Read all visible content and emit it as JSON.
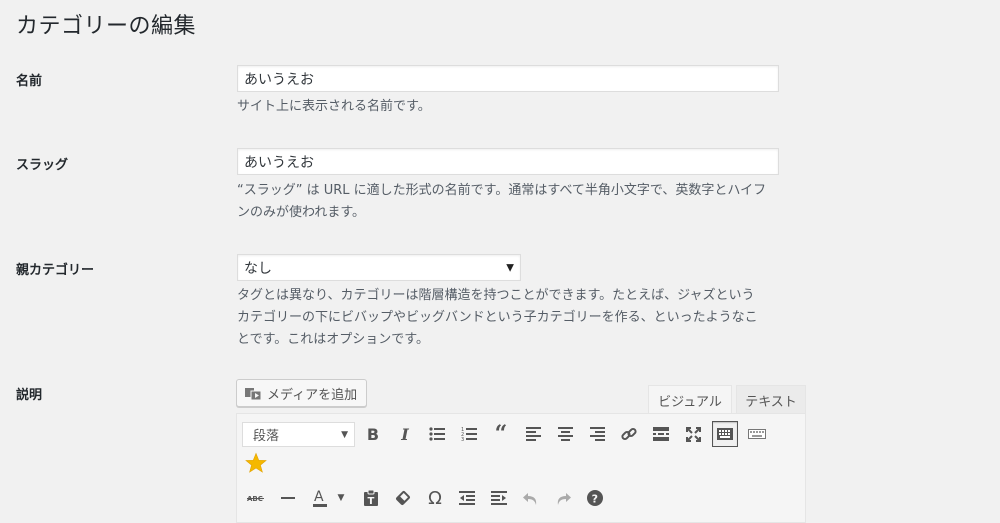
{
  "page": {
    "title": "カテゴリーの編集"
  },
  "name": {
    "label": "名前",
    "value": "あいうえお",
    "description": "サイト上に表示される名前です。"
  },
  "slug": {
    "label": "スラッグ",
    "value": "あいうえお",
    "description_1": "“スラッグ” は URL に適した形式の名前です。通常はすべて半角小文字で、英数字とハイフ",
    "description_2": "ンのみが使われます。"
  },
  "parent": {
    "label": "親カテゴリー",
    "selected": "なし",
    "description_1": "タグとは異なり、カテゴリーは階層構造を持つことができます。たとえば、ジャズという",
    "description_2": "カテゴリーの下にビバップやビッグバンドという子カテゴリーを作る、といったようなこ",
    "description_3": "とです。これはオプションです。"
  },
  "description": {
    "label": "説明",
    "add_media_label": "メディアを追加",
    "tabs": {
      "visual": "ビジュアル",
      "text": "テキスト"
    },
    "format_select": "段落",
    "toolbar_icons": [
      "bold-icon",
      "italic-icon",
      "bullet-list-icon",
      "numbered-list-icon",
      "blockquote-icon",
      "align-left-icon",
      "align-center-icon",
      "align-right-icon",
      "link-icon",
      "read-more-icon",
      "fullscreen-icon",
      "toolbar-toggle-icon",
      "keyboard-icon",
      "star-icon",
      "strikethrough-icon",
      "horizontal-line-icon",
      "text-color-icon",
      "paste-text-icon",
      "clear-formatting-icon",
      "special-character-icon",
      "outdent-icon",
      "indent-icon",
      "undo-icon",
      "redo-icon",
      "help-icon"
    ]
  }
}
